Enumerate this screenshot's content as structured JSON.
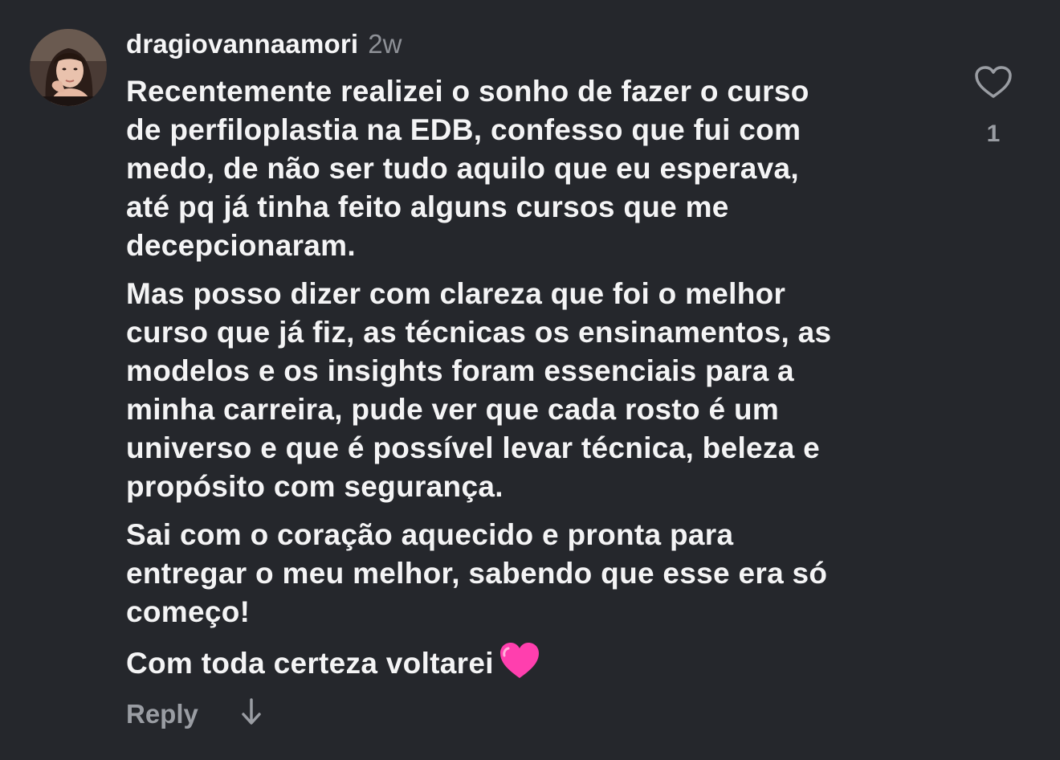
{
  "comment": {
    "username": "dragiovannaamori",
    "time": "2w",
    "paragraphs": [
      {
        "lines": [
          "Recentemente realizei o sonho de fazer o curso",
          "de perfiloplastia na EDB, confesso que fui com",
          "medo, de não ser tudo aquilo que eu esperava,",
          "até pq já tinha feito alguns cursos que me",
          "decepcionaram."
        ]
      },
      {
        "lines": [
          "Mas posso dizer com clareza que foi o melhor",
          "curso que já fiz, as técnicas os ensinamentos, as",
          "modelos e os insights foram essenciais para a",
          "minha carreira, pude ver que cada rosto é um",
          "universo e que é possível levar técnica, beleza e",
          "propósito com segurança."
        ]
      },
      {
        "lines": [
          "Sai com o coração aquecido e pronta para",
          "entregar o meu melhor, sabendo que esse era só",
          "começo!"
        ]
      },
      {
        "lines": [
          "Com toda certeza voltarei"
        ],
        "trailing_emoji": "pink-heart-emoji"
      }
    ],
    "reply_label": "Reply",
    "like_count": "1",
    "icons": {
      "like": "heart-outline-icon",
      "translate": "arrow-down-icon",
      "avatar": "profile-photo"
    },
    "colors": {
      "background": "#25272c",
      "text": "#f4f4f5",
      "muted": "#9a9da3",
      "heart_emoji": "#ff3fae"
    }
  }
}
